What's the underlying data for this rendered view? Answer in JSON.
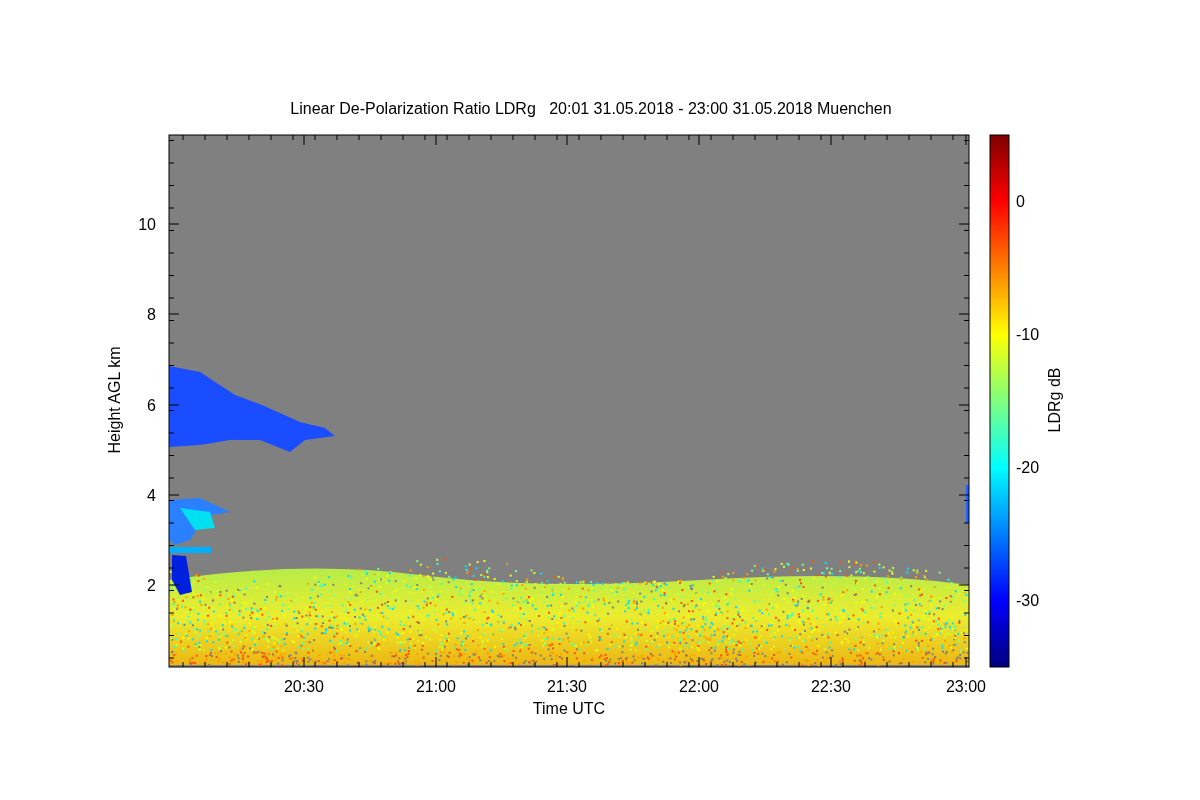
{
  "title": "Linear De-Polarization Ratio LDRg   20:01 31.05.2018 - 23:00 31.05.2018 Muenchen",
  "ylabel": "Height AGL km",
  "xlabel": "Time UTC",
  "yticks": [
    "10",
    "8",
    "6",
    "4",
    "2"
  ],
  "xticks": [
    "20:30",
    "21:00",
    "21:30",
    "22:00",
    "22:30",
    "23:00"
  ],
  "colorbar": {
    "label": "LDRg dB",
    "ticks": [
      "0",
      "-10",
      "-20",
      "-30"
    ]
  }
}
